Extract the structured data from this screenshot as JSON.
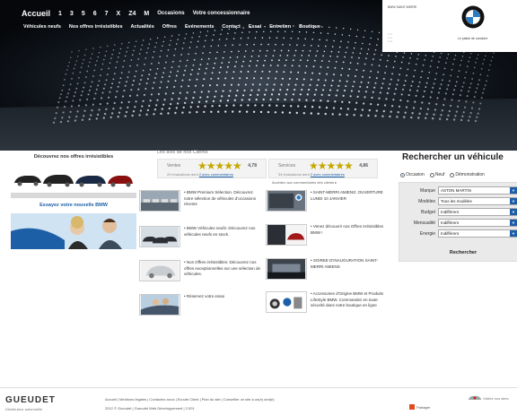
{
  "header": {
    "nav": [
      "Accueil",
      "1",
      "3",
      "5",
      "6",
      "7",
      "X",
      "Z4",
      "M",
      "Occasions",
      "Votre concessionnaire"
    ],
    "subnav": [
      "Véhicules neufs",
      "Nos offres irrésistibles",
      "Actualités",
      "Offres",
      "Evénements",
      "Contact",
      "Essai",
      "Entretien",
      "Boutique"
    ],
    "dealer_box": {
      "address": "BMW SAINT-MERRI",
      "tagline": "Le plaisir de conduire"
    }
  },
  "left_promo": {
    "offers_title": "Découvrez nos offres irrésistibles",
    "try_title": "Essayez votre nouvelle BMW"
  },
  "reviews": {
    "heading": "Les avis de nos Clients",
    "boxes": [
      {
        "label": "Ventes",
        "stars": "★★★★★",
        "score": "4,78",
        "count": "20 évaluations dont",
        "link": "2 avec commentaires"
      },
      {
        "label": "Services",
        "stars": "★★★★★",
        "score": "4,86",
        "count": "34 évaluations dont",
        "link": "2 avec commentaires"
      }
    ],
    "more": "Accédez aux commentaires des clients ▸"
  },
  "items_left": [
    {
      "text": "• BMW Premium Sélection. Découvrez notre sélection de véhicules d'occasions récents"
    },
    {
      "text": "• BMW Véhicules neufs: Découvrez nos véhicules neufs en stock."
    },
    {
      "text": "• Nos Offres irrésistibles: Découvrez nos offres exceptionnelles sur une sélection de véhicules."
    },
    {
      "text": "• Réservez votre essai"
    }
  ],
  "items_right": [
    {
      "text": "• SAINT-MERRI AMIENS: OUVERTURE LUNDI 10 JANVIER"
    },
    {
      "text": "• Venez découvrir nos Offres Irrésistibles BMW !"
    },
    {
      "text": "• SOIREE D'INAUGURATION SAINT-MERRI AMIENS"
    },
    {
      "text": "• Accessoires d'Origine BMW et Produits LifeStyle BMW. Commandez en toute sécurité dans notre boutique en ligne"
    }
  ],
  "search": {
    "title": "Rechercher un véhicule",
    "radios": [
      {
        "label": "Occasion",
        "selected": true
      },
      {
        "label": "Neuf",
        "selected": false
      },
      {
        "label": "Démonstration",
        "selected": false
      }
    ],
    "fields": [
      {
        "label": "Marque",
        "value": "ASTON MARTIN"
      },
      {
        "label": "Modèles",
        "value": "Tous les modèles"
      },
      {
        "label": "Budget",
        "value": "Indifférent"
      },
      {
        "label": "Mensualité",
        "value": "Indifférent"
      },
      {
        "label": "Energie",
        "value": "Indifférent"
      }
    ],
    "button": "Rechercher"
  },
  "footer": {
    "logo": "GUEUDET",
    "sub": "Distributeur automobile",
    "links": "Accueil | Mentions légales | Contactez-nous | Ecoute Client | Plan du site | Conseiller ce site à un(e) ami(e)",
    "copy": "2012 © Gueudet | Gueudet Web Développement | 2.001",
    "share": "Partager",
    "visit": "Visitez nos sites"
  },
  "colors": {
    "accent_blue": "#1d5fa6",
    "share_orange": "#e04a1f",
    "star_gold": "#c5a800"
  }
}
